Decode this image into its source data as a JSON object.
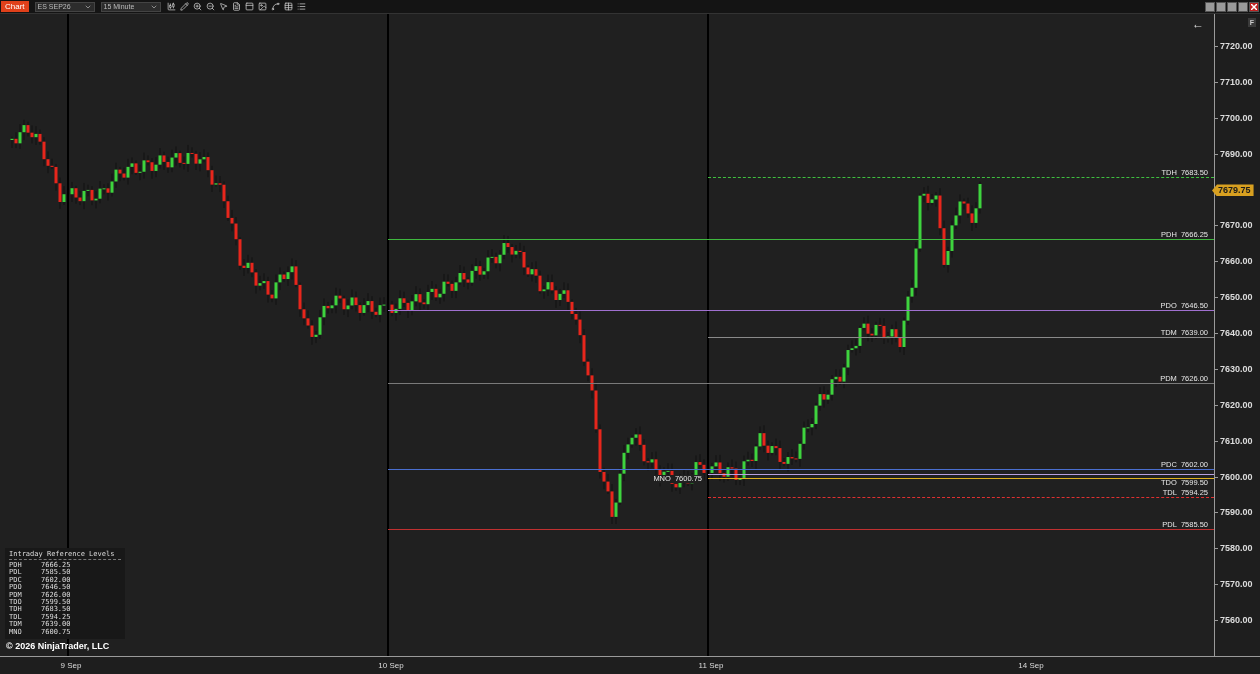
{
  "toolbar": {
    "tab": "Chart",
    "instrument": "ES SEP26",
    "interval": "15 Minute"
  },
  "chart": {
    "back_arrow": "←",
    "corner_button": "F",
    "price_axis": [
      "7720.00",
      "7710.00",
      "7700.00",
      "7690.00",
      "7670.00",
      "7660.00",
      "7650.00",
      "7640.00",
      "7630.00",
      "7620.00",
      "7610.00",
      "7600.00",
      "7590.00",
      "7580.00",
      "7570.00",
      "7560.00"
    ],
    "current_price": "7679.75",
    "time_axis": [
      {
        "label": "9 Sep",
        "separator": true
      },
      {
        "label": "10 Sep",
        "separator": true
      },
      {
        "label": "11 Sep",
        "separator": true
      },
      {
        "label": "14 Sep",
        "separator": false
      }
    ],
    "levels": [
      {
        "label": "TDH",
        "value": "7683.50",
        "color": "#3fbf3f",
        "dashed": true,
        "kind": "today",
        "label_below": false,
        "label_at_start": false
      },
      {
        "label": "PDH",
        "value": "7666.25",
        "color": "#3fb83f",
        "dashed": false,
        "kind": "prior",
        "label_below": false,
        "label_at_start": false
      },
      {
        "label": "PDO",
        "value": "7646.50",
        "color": "#a070d0",
        "dashed": false,
        "kind": "prior",
        "label_below": false,
        "label_at_start": false
      },
      {
        "label": "TDM",
        "value": "7639.00",
        "color": "#8a8a8a",
        "dashed": false,
        "kind": "today",
        "label_below": false,
        "label_at_start": false
      },
      {
        "label": "PDM",
        "value": "7626.00",
        "color": "#7a7a7a",
        "dashed": false,
        "kind": "prior",
        "label_below": false,
        "label_at_start": false
      },
      {
        "label": "PDC",
        "value": "7602.00",
        "color": "#4a6fd0",
        "dashed": false,
        "kind": "prior",
        "label_below": false,
        "label_at_start": false
      },
      {
        "label": "MNO",
        "value": "7600.75",
        "color": "#b8a0e0",
        "dashed": false,
        "kind": "today",
        "label_below": true,
        "label_at_start": true
      },
      {
        "label": "TDO",
        "value": "7599.50",
        "color": "#e0b020",
        "dashed": false,
        "kind": "today",
        "label_below": true,
        "label_at_start": false
      },
      {
        "label": "TDL",
        "value": "7594.25",
        "color": "#e03030",
        "dashed": true,
        "kind": "today",
        "label_below": false,
        "label_at_start": false
      },
      {
        "label": "PDL",
        "value": "7585.50",
        "color": "#c03030",
        "dashed": false,
        "kind": "prior",
        "label_below": false,
        "label_at_start": false
      }
    ],
    "watermark": "© 2026 NinjaTrader, LLC"
  },
  "reference_table": {
    "title": "Intraday Reference Levels",
    "rows": [
      {
        "label": "PDH",
        "value": "7666.25"
      },
      {
        "label": "PDL",
        "value": "7585.50"
      },
      {
        "label": "PDC",
        "value": "7602.00"
      },
      {
        "label": "PDO",
        "value": "7646.50"
      },
      {
        "label": "PDM",
        "value": "7626.00"
      },
      {
        "label": "TDO",
        "value": "7599.50"
      },
      {
        "label": "TDH",
        "value": "7683.50"
      },
      {
        "label": "TDL",
        "value": "7594.25"
      },
      {
        "label": "TDM",
        "value": "7639.00"
      },
      {
        "label": "MNO",
        "value": "7600.75"
      }
    ]
  }
}
